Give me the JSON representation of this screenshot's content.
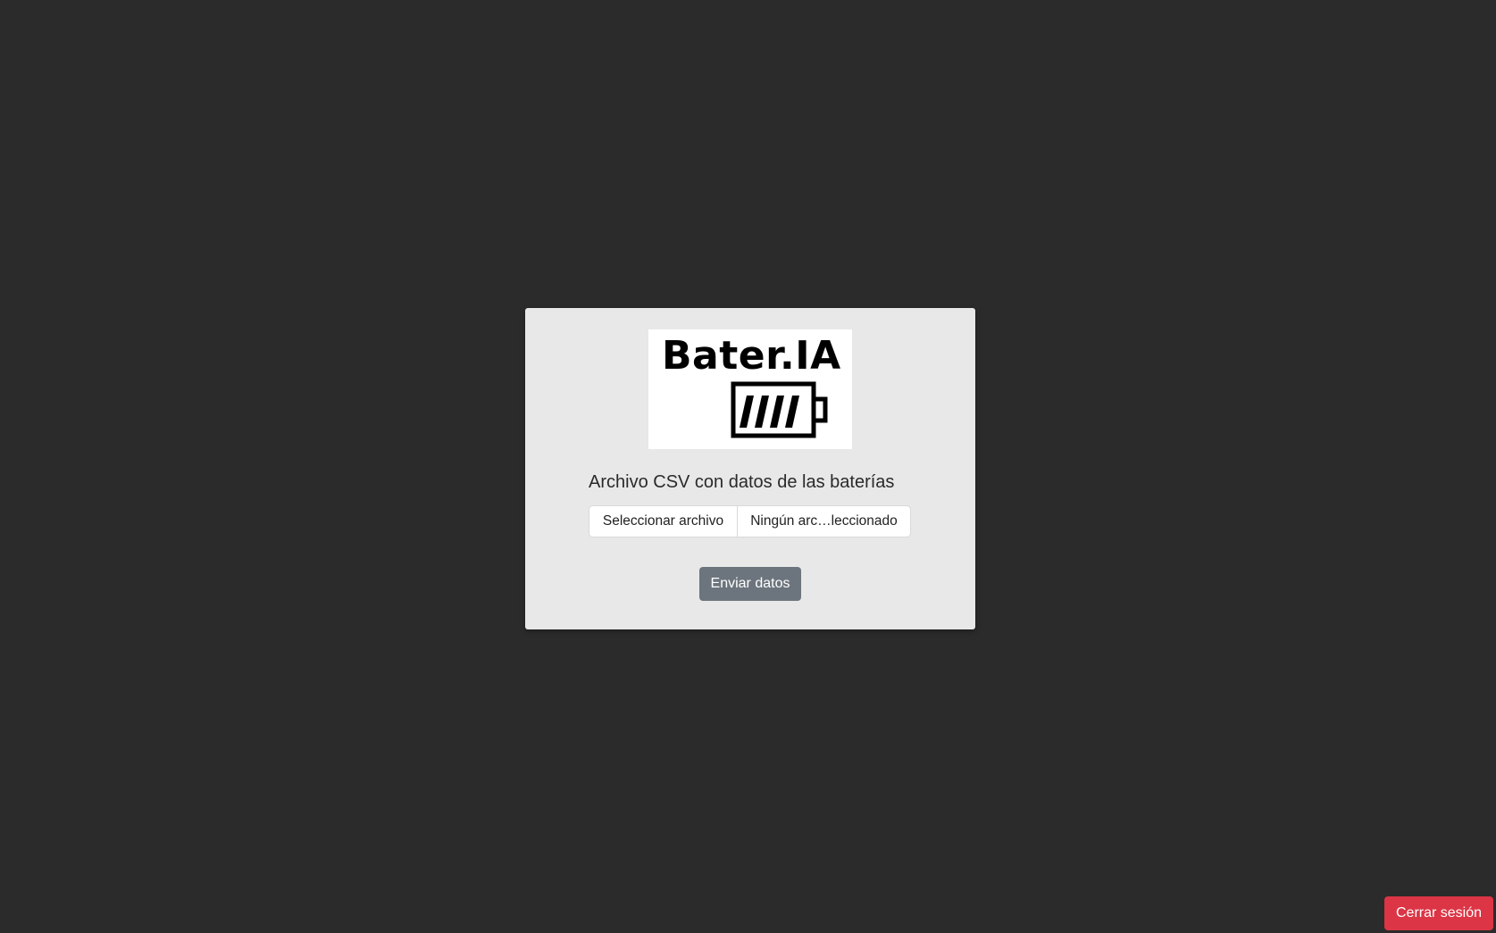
{
  "logo": {
    "text": "Bater.IA",
    "icon": "battery-icon"
  },
  "upload_form": {
    "label": "Archivo CSV con datos de las baterías",
    "file_button_label": "Seleccionar archivo",
    "file_status": "Ningún arc…leccionado",
    "submit_label": "Enviar datos"
  },
  "logout": {
    "label": "Cerrar sesión"
  },
  "colors": {
    "page_background": "#2b2b2b",
    "card_background": "#e8e8e8",
    "submit_button": "#6c757d",
    "logout_button": "#dc3545"
  }
}
